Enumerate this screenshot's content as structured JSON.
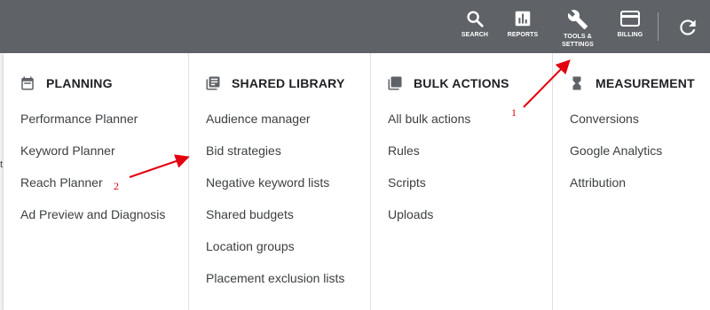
{
  "toolbar": {
    "search_label": "SEARCH",
    "reports_label": "REPORTS",
    "tools_label_line1": "TOOLS &",
    "tools_label_line2": "SETTINGS",
    "billing_label": "BILLING"
  },
  "menu": {
    "planning": {
      "title": "PLANNING",
      "items": [
        "Performance Planner",
        "Keyword Planner",
        "Reach Planner",
        "Ad Preview and Diagnosis"
      ]
    },
    "shared_library": {
      "title": "SHARED LIBRARY",
      "items": [
        "Audience manager",
        "Bid strategies",
        "Negative keyword lists",
        "Shared budgets",
        "Location groups",
        "Placement exclusion lists"
      ]
    },
    "bulk_actions": {
      "title": "BULK ACTIONS",
      "items": [
        "All bulk actions",
        "Rules",
        "Scripts",
        "Uploads"
      ]
    },
    "measurement": {
      "title": "MEASUREMENT",
      "items": [
        "Conversions",
        "Google Analytics",
        "Attribution"
      ]
    }
  },
  "annotations": {
    "one": "1",
    "two": "2"
  },
  "stray_text": "t",
  "colors": {
    "topbar": "#5f6368",
    "annotation": "#e3000f",
    "text": "#3c4043"
  }
}
